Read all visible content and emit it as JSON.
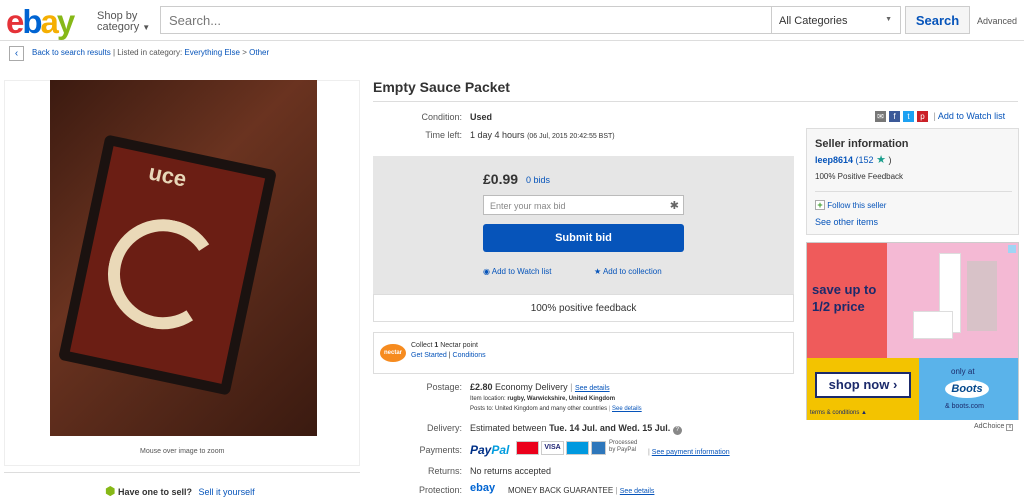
{
  "header": {
    "logo": {
      "e": "e",
      "b": "b",
      "a": "a",
      "y": "y"
    },
    "shop_by": "Shop by",
    "category": "category",
    "search_placeholder": "Search...",
    "category_select": "All Categories",
    "search_button": "Search",
    "advanced": "Advanced"
  },
  "breadcrumb": {
    "back": "Back to search results",
    "listed": "| Listed in category:",
    "cat1": "Everything Else",
    "sep": ">",
    "cat2": "Other"
  },
  "gallery": {
    "packet_text": "uce",
    "zoom_hint": "Mouse over image to zoom"
  },
  "sell": {
    "question": "Have one to sell?",
    "link": "Sell it yourself"
  },
  "item": {
    "title": "Empty Sauce Packet",
    "condition_label": "Condition:",
    "condition": "Used",
    "time_label": "Time left:",
    "time_left": "1 day 4 hours",
    "time_detail": "(06 Jul, 2015   20:42:55 BST)"
  },
  "social": {
    "watch": "Add to Watch list"
  },
  "bid": {
    "price": "£0.99",
    "bids": "0 bids",
    "max_placeholder": "Enter your max bid",
    "submit": "Submit bid",
    "watch": "Add to Watch list",
    "collection": "Add to collection",
    "feedback": "100% positive feedback"
  },
  "nectar": {
    "logo": "nectar",
    "collect": "Collect",
    "points": "1",
    "point_text": "Nectar point",
    "get_started": "Get Started",
    "sep": "|",
    "conditions": "Conditions"
  },
  "postage": {
    "label": "Postage:",
    "price": "£2.80",
    "method": "Economy Delivery",
    "sep": "|",
    "details": "See details",
    "location_label": "Item location:",
    "location": "rugby, Warwickshire, United Kingdom",
    "posts_label": "Posts to:",
    "posts": "United Kingdom and many other countries",
    "posts_details": "See details"
  },
  "delivery": {
    "label": "Delivery:",
    "prefix": "Estimated between",
    "dates": "Tue. 14 Jul. and Wed. 15 Jul."
  },
  "payments": {
    "label": "Payments:",
    "paypal_a": "Pay",
    "paypal_b": "Pal",
    "processed": "Processed",
    "by_paypal": "by PayPal",
    "sep": "|",
    "link": "See payment information",
    "cards": [
      "MasterCard",
      "VISA",
      "Maestro",
      "AMEX"
    ]
  },
  "returns": {
    "label": "Returns:",
    "value": "No returns accepted"
  },
  "protection": {
    "label": "Protection:",
    "ebay": "ebay",
    "guarantee": "MONEY BACK GUARANTEE",
    "sep": "|",
    "link": "See details"
  },
  "seller": {
    "heading": "Seller information",
    "name": "leep8614",
    "score_open": "(152",
    "score_close": ")",
    "positive": "100% Positive Feedback",
    "follow": "Follow this seller",
    "other": "See other items"
  },
  "ad": {
    "save": "save up to 1/2 price",
    "shop": "shop now",
    "only_at": "only at",
    "boots": "Boots",
    "boots_url": "& boots.com",
    "terms": "terms & conditions",
    "adchoice": "AdChoice"
  },
  "colors": {
    "ebay_red": "#e53238",
    "ebay_blue": "#0064d2",
    "ebay_yellow": "#f5af02",
    "ebay_green": "#86b817",
    "link": "#0654ba",
    "submit": "#0654ba"
  }
}
